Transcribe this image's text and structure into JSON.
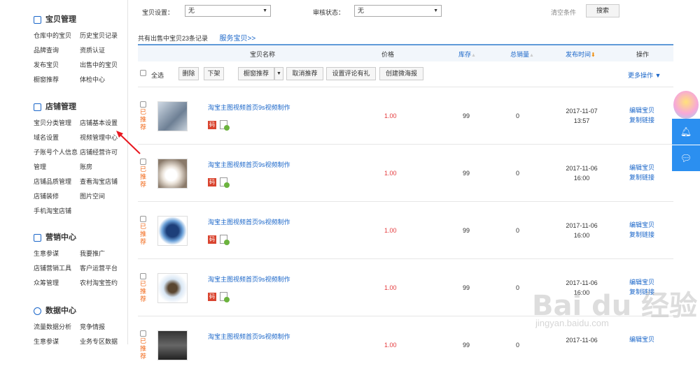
{
  "sidebar": {
    "sections": [
      {
        "title": "宝贝管理",
        "links": [
          "仓库中的宝贝",
          "历史宝贝记录",
          "品牌查询",
          "资质认证",
          "发布宝贝",
          "出售中的宝贝",
          "橱窗推荐",
          "体检中心"
        ]
      },
      {
        "title": "店铺管理",
        "links": [
          "宝贝分类管理",
          "店铺基本设置",
          "域名设置",
          "视频管理中心",
          "子账号个人信息",
          "店铺经营许可",
          "管理",
          "账房",
          "店铺品质管理",
          "查看淘宝店铺",
          "店铺装修",
          "图片空间",
          "手机淘宝店铺",
          ""
        ]
      },
      {
        "title": "营销中心",
        "links": [
          "生意参谋",
          "我要推广",
          "店铺营销工具",
          "客户运营平台",
          "众筹管理",
          "农村淘宝签约"
        ]
      },
      {
        "title": "数据中心",
        "links": [
          "流量数据分析",
          "竞争情报",
          "生意参谋",
          "业务专区数据"
        ]
      }
    ]
  },
  "filters": {
    "setting_label": "宝贝设置：",
    "setting_value": "无",
    "review_label": "审核状态：",
    "review_value": "无",
    "clear_label": "清空条件",
    "search_label": "搜索"
  },
  "summary": {
    "text": "共有出售中宝贝23条记录",
    "service_link": "服务宝贝>>"
  },
  "table_header": {
    "name": "宝贝名称",
    "price": "价格",
    "stock": "库存",
    "sales": "总销量",
    "date": "发布时间",
    "ops": "操作"
  },
  "actions": {
    "select_all": "全选",
    "delete": "删除",
    "delist": "下架",
    "window_recommend": "橱窗推荐",
    "cancel_recommend": "取消推荐",
    "review_gift": "设置评论有礼",
    "create_poster": "创建微海报",
    "more_ops": "更多操作 ▼"
  },
  "rows": [
    {
      "recommend": "已推荐",
      "title": "淘宝主图视频首页9s视频制作",
      "price": "1.00",
      "stock": "99",
      "sales": "0",
      "date": "2017-11-07",
      "time": "13:57",
      "edit": "编辑宝贝",
      "copy": "复制链接"
    },
    {
      "recommend": "已推荐",
      "title": "淘宝主图视频首页9s视频制作",
      "price": "1.00",
      "stock": "99",
      "sales": "0",
      "date": "2017-11-06",
      "time": "16:00",
      "edit": "编辑宝贝",
      "copy": "复制链接"
    },
    {
      "recommend": "已推荐",
      "title": "淘宝主图视频首页9s视频制作",
      "price": "1.00",
      "stock": "99",
      "sales": "0",
      "date": "2017-11-06",
      "time": "16:00",
      "edit": "编辑宝贝",
      "copy": "复制链接"
    },
    {
      "recommend": "已推荐",
      "title": "淘宝主图视频首页9s视频制作",
      "price": "1.00",
      "stock": "99",
      "sales": "0",
      "date": "2017-11-06",
      "time": "16:00",
      "edit": "编辑宝贝",
      "copy": "复制链接"
    },
    {
      "recommend": "已推荐",
      "title": "淘宝主图视频首页9s视频制作",
      "price": "1.00",
      "stock": "99",
      "sales": "0",
      "date": "2017-11-06",
      "time": "",
      "edit": "编辑宝贝",
      "copy": ""
    }
  ],
  "code_badge": "码",
  "watermark": {
    "main": "Bai du 经验",
    "sub": "jingyan.baidu.com"
  },
  "colors": {
    "link": "#1a66c9",
    "price": "#e4393c",
    "recommend": "#f26b1d",
    "header_border": "#5f9ad8",
    "float": "#2b8ff0"
  }
}
